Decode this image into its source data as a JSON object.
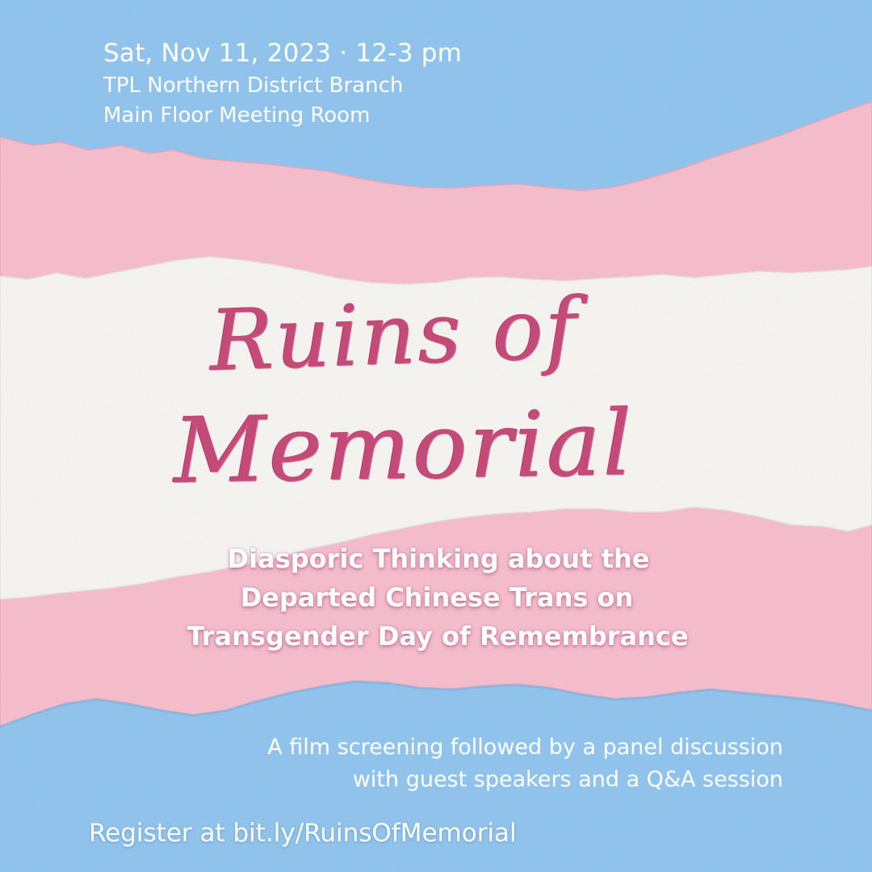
{
  "event": {
    "date_time": "Sat, Nov 11, 2023 · 12-3 pm",
    "venue": "TPL Northern District Branch",
    "room": "Main Floor Meeting Room"
  },
  "title": {
    "line1": "Ruins of",
    "line2": "Memorial"
  },
  "subtitle": {
    "line1": "Diasporic Thinking about  the",
    "line2": "Departed Chinese Trans on",
    "line3": "Transgender Day of Remembrance"
  },
  "details": {
    "line1": "A film screening followed by  a panel discussion",
    "line2": "with guest speakers and a Q&A session"
  },
  "registration": {
    "text": "Register at bit.ly/RuinsOfMemorial"
  },
  "colors": {
    "blue": "#8fc3ec",
    "pink": "#f5bccb",
    "white": "#f4f3f0",
    "title": "#c44a78"
  }
}
